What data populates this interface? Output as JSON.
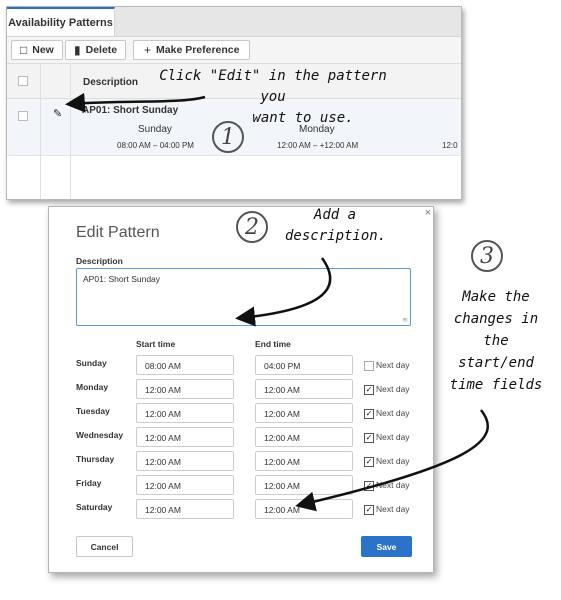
{
  "top_panel": {
    "tab_label": "Availability Patterns",
    "toolbar": {
      "new_label": "New",
      "delete_label": "Delete",
      "make_preference_label": "Make Preference",
      "new_icon": "document-icon",
      "delete_icon": "trash-icon",
      "make_preference_icon": "plus-icon"
    },
    "columns": {
      "description": "Description"
    },
    "row": {
      "title": "AP01: Short Sunday",
      "days": [
        {
          "day": "Sunday",
          "time": "08:00 AM  –  04:00 PM"
        },
        {
          "day": "Monday",
          "time": "12:00 AM  –  +12:00 AM"
        },
        {
          "day": "",
          "time": "12:0"
        }
      ]
    }
  },
  "dialog": {
    "title": "Edit Pattern",
    "close_glyph": "×",
    "description_label": "Description",
    "description_value": "AP01: Short Sunday",
    "start_header": "Start time",
    "end_header": "End time",
    "next_day_label": "Next day",
    "rows": [
      {
        "day": "Sunday",
        "start": "08:00 AM",
        "end": "04:00 PM",
        "next_day": false
      },
      {
        "day": "Monday",
        "start": "12:00 AM",
        "end": "12:00 AM",
        "next_day": true
      },
      {
        "day": "Tuesday",
        "start": "12:00 AM",
        "end": "12:00 AM",
        "next_day": true
      },
      {
        "day": "Wednesday",
        "start": "12:00 AM",
        "end": "12:00 AM",
        "next_day": true
      },
      {
        "day": "Thursday",
        "start": "12:00 AM",
        "end": "12:00 AM",
        "next_day": true
      },
      {
        "day": "Friday",
        "start": "12:00 AM",
        "end": "12:00 AM",
        "next_day": true
      },
      {
        "day": "Saturday",
        "start": "12:00 AM",
        "end": "12:00 AM",
        "next_day": true
      }
    ],
    "cancel_label": "Cancel",
    "save_label": "Save",
    "save_color": "#2b73c9"
  },
  "annotations": {
    "step1_number": "1",
    "step1_line1": "Click \"Edit\" in the pattern you",
    "step1_line2": "want to use.",
    "step2_number": "2",
    "step2_line1": "Add a",
    "step2_line2": "description.",
    "step3_number": "3",
    "step3_line1": "Make the",
    "step3_line2": "changes in",
    "step3_line3": "the",
    "step3_line4": "start/end",
    "step3_line5": "time fields"
  }
}
